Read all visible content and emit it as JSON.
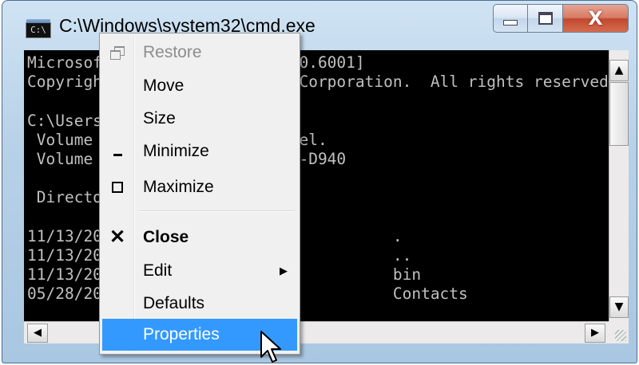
{
  "window": {
    "title": "C:\\Windows\\system32\\cmd.exe",
    "icon": "cmd-icon",
    "icon_text": "C:\\",
    "caption_buttons": [
      "minimize-icon",
      "maximize-icon",
      "close-icon"
    ]
  },
  "console": {
    "lines": [
      "Microsoft Windows [Version 6.0.6001]",
      "Copyright (c) 2006 Microsoft Corporation.  All rights reserved.",
      "",
      "C:\\Users\\geek>dir",
      " Volume in drive C has no label.",
      " Volume Serial Number is 0CFD-D940",
      "",
      " Directory of C:\\Users\\geek",
      "",
      "11/13/2008  09:47 PM    <DIR>          .",
      "11/13/2008  09:47 PM    <DIR>          ..",
      "11/13/2008  09:31 PM    <DIR>          bin",
      "05/28/2008  11:27 PM    <DIR>          Contacts"
    ]
  },
  "menu": {
    "items": [
      {
        "label": "Restore",
        "icon": "restore-icon",
        "state": "disabled"
      },
      {
        "label": "Move",
        "icon": "",
        "state": "normal"
      },
      {
        "label": "Size",
        "icon": "",
        "state": "normal"
      },
      {
        "label": "Minimize",
        "icon": "minimize-icon",
        "state": "normal"
      },
      {
        "label": "Maximize",
        "icon": "maximize-icon",
        "state": "normal"
      },
      {
        "label": "Close",
        "icon": "close-icon",
        "state": "default-bold"
      },
      {
        "label": "Edit",
        "icon": "submenu-arrow-icon",
        "state": "normal"
      },
      {
        "label": "Defaults",
        "icon": "",
        "state": "normal"
      },
      {
        "label": "Properties",
        "icon": "",
        "state": "highlighted"
      }
    ],
    "highlight_color": "#3399ff"
  },
  "scrollbars": {
    "up": "▲",
    "down": "▼",
    "left": "◀",
    "right": "▶"
  },
  "colors": {
    "console_bg": "#000000",
    "console_fg": "#c0c0c0",
    "close_button": "#c94a30"
  }
}
